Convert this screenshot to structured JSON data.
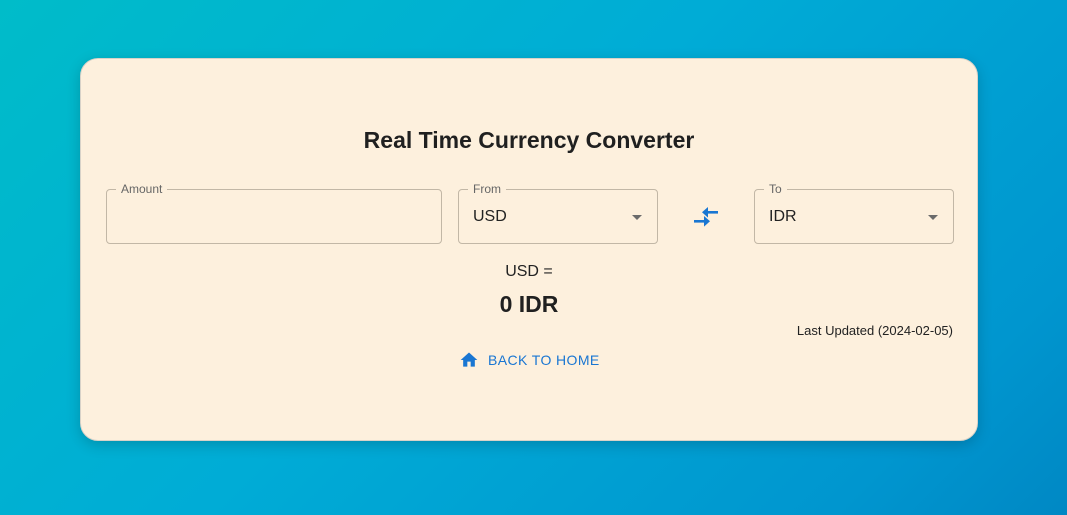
{
  "converter": {
    "title": "Real Time Currency Converter",
    "amount": {
      "label": "Amount",
      "value": ""
    },
    "from": {
      "label": "From",
      "value": "USD"
    },
    "to": {
      "label": "To",
      "value": "IDR"
    },
    "result_from": "USD =",
    "result_to": "0 IDR",
    "last_updated": "Last Updated (2024-02-05)",
    "back_label": "BACK TO HOME"
  },
  "colors": {
    "accent": "#1976d2",
    "card_background": "#fdf0dd"
  },
  "icons": {
    "swap": "compare-arrows-icon",
    "home": "home-icon",
    "dropdown": "arrow-drop-down-icon"
  }
}
